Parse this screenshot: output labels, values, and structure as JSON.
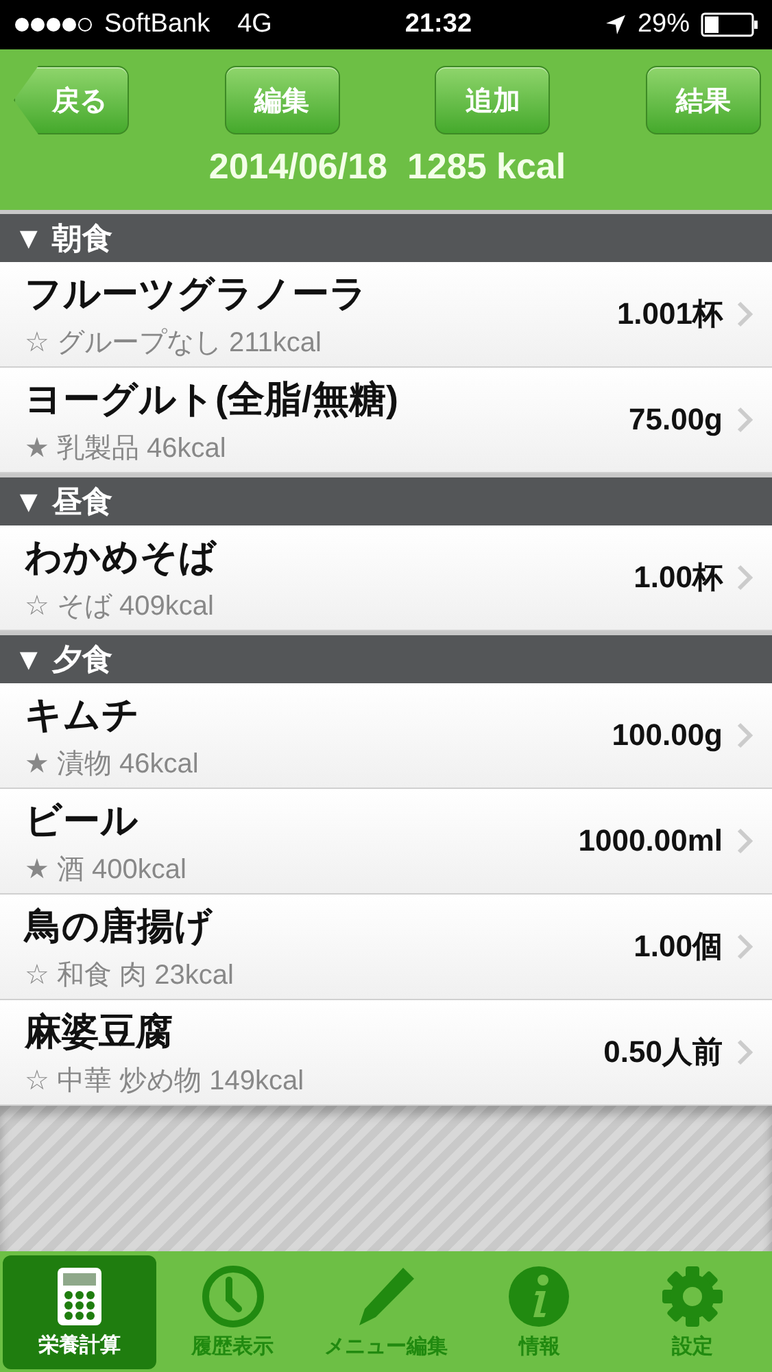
{
  "status_bar": {
    "carrier": "SoftBank",
    "network": "4G",
    "time": "21:32",
    "battery": "29%"
  },
  "nav": {
    "back": "戻る",
    "buttons": [
      "編集",
      "追加",
      "結果"
    ],
    "summary": "2014/06/18  1285 kcal"
  },
  "sections": [
    {
      "title": "▼ 朝食",
      "rows": [
        {
          "name": "フルーツグラノーラ",
          "detail": "☆ グループなし 211kcal",
          "amount": "1.001杯"
        },
        {
          "name": "ヨーグルト(全脂/無糖)",
          "detail": "★ 乳製品 46kcal",
          "amount": "75.00g"
        }
      ]
    },
    {
      "title": "▼ 昼食",
      "rows": [
        {
          "name": "わかめそば",
          "detail": "☆ そば 409kcal",
          "amount": "1.00杯"
        }
      ]
    },
    {
      "title": "▼ 夕食",
      "rows": [
        {
          "name": "キムチ",
          "detail": "★ 漬物 46kcal",
          "amount": "100.00g"
        },
        {
          "name": "ビール",
          "detail": "★ 酒 400kcal",
          "amount": "1000.00ml"
        },
        {
          "name": "鳥の唐揚げ",
          "detail": "☆ 和食 肉 23kcal",
          "amount": "1.00個"
        },
        {
          "name": "麻婆豆腐",
          "detail": "☆ 中華 炒め物 149kcal",
          "amount": "0.50人前"
        }
      ]
    }
  ],
  "tabs": [
    {
      "kind": "calculator",
      "label": "栄養計算",
      "selected": true
    },
    {
      "kind": "clock",
      "label": "履歴表示",
      "selected": false
    },
    {
      "kind": "pencil",
      "label": "メニュー編集",
      "selected": false
    },
    {
      "kind": "info",
      "label": "情報",
      "selected": false
    },
    {
      "kind": "gear",
      "label": "設定",
      "selected": false
    }
  ]
}
